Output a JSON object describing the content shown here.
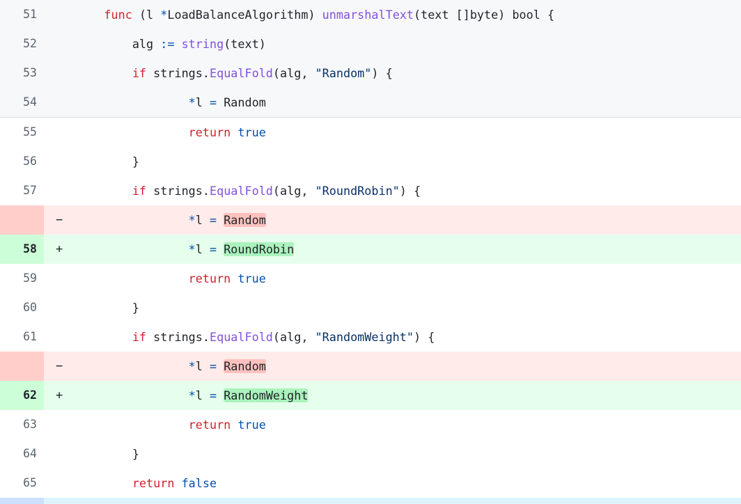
{
  "view": {
    "kind": "code-diff-unified",
    "language": "Go",
    "colors": {
      "page_bg": "#ffffff",
      "shaded_row_bg": "#f6f8fa",
      "shaded_row_border": "#d8dee4",
      "deletion_bg": "#ffebe9",
      "deletion_gutter_bg": "#ffcecb",
      "deletion_word_bg": "#ffc1bd",
      "addition_bg": "#e6ffec",
      "addition_gutter_bg": "#ccffd8",
      "addition_word_bg": "#abf2bc",
      "hunk_gutter_bg": "#cce0ff",
      "hunk_content_bg": "#ddf4ff",
      "line_number_color": "#59636e",
      "keyword": "#cf222e",
      "function": "#8250df",
      "operator_constant": "#0550ae",
      "string": "#0a3069",
      "plain": "#1f2328"
    }
  },
  "rows": [
    {
      "line_number": "51",
      "marker": "",
      "type": "shaded",
      "code_plain": "func (l *LoadBalanceAlgorithm) unmarshalText(text []byte) bool {",
      "tokens": [
        {
          "t": "    ",
          "c": "pl"
        },
        {
          "t": "func",
          "c": "kw"
        },
        {
          "t": " (l ",
          "c": "pl"
        },
        {
          "t": "*",
          "c": "op"
        },
        {
          "t": "LoadBalanceAlgorithm) ",
          "c": "pl"
        },
        {
          "t": "unmarshalText",
          "c": "fn"
        },
        {
          "t": "(text []byte) bool {",
          "c": "pl"
        }
      ]
    },
    {
      "line_number": "52",
      "marker": "",
      "type": "shaded",
      "code_plain": "        alg := string(text)",
      "tokens": [
        {
          "t": "        alg ",
          "c": "pl"
        },
        {
          "t": ":=",
          "c": "op"
        },
        {
          "t": " ",
          "c": "pl"
        },
        {
          "t": "string",
          "c": "fn"
        },
        {
          "t": "(text)",
          "c": "pl"
        }
      ]
    },
    {
      "line_number": "53",
      "marker": "",
      "type": "shaded",
      "code_plain": "        if strings.EqualFold(alg, \"Random\") {",
      "tokens": [
        {
          "t": "        ",
          "c": "pl"
        },
        {
          "t": "if",
          "c": "kw"
        },
        {
          "t": " strings.",
          "c": "pl"
        },
        {
          "t": "EqualFold",
          "c": "fn"
        },
        {
          "t": "(alg, ",
          "c": "pl"
        },
        {
          "t": "\"Random\"",
          "c": "str"
        },
        {
          "t": ") {",
          "c": "pl"
        }
      ]
    },
    {
      "line_number": "54",
      "marker": "",
      "type": "shaded-last",
      "code_plain": "                *l = Random",
      "tokens": [
        {
          "t": "                ",
          "c": "pl"
        },
        {
          "t": "*",
          "c": "op"
        },
        {
          "t": "l ",
          "c": "pl"
        },
        {
          "t": "=",
          "c": "op"
        },
        {
          "t": " Random",
          "c": "pl"
        }
      ]
    },
    {
      "line_number": "55",
      "marker": "",
      "type": "context",
      "code_plain": "                return true",
      "tokens": [
        {
          "t": "                ",
          "c": "pl"
        },
        {
          "t": "return",
          "c": "kw"
        },
        {
          "t": " ",
          "c": "pl"
        },
        {
          "t": "true",
          "c": "op"
        }
      ]
    },
    {
      "line_number": "56",
      "marker": "",
      "type": "context",
      "code_plain": "        }",
      "tokens": [
        {
          "t": "        }",
          "c": "pl"
        }
      ]
    },
    {
      "line_number": "57",
      "marker": "",
      "type": "context",
      "code_plain": "        if strings.EqualFold(alg, \"RoundRobin\") {",
      "tokens": [
        {
          "t": "        ",
          "c": "pl"
        },
        {
          "t": "if",
          "c": "kw"
        },
        {
          "t": " strings.",
          "c": "pl"
        },
        {
          "t": "EqualFold",
          "c": "fn"
        },
        {
          "t": "(alg, ",
          "c": "pl"
        },
        {
          "t": "\"RoundRobin\"",
          "c": "str"
        },
        {
          "t": ") {",
          "c": "pl"
        }
      ]
    },
    {
      "line_number": "",
      "marker": "−",
      "type": "deletion",
      "code_plain": "                *l = Random",
      "tokens": [
        {
          "t": "                ",
          "c": "pl"
        },
        {
          "t": "*",
          "c": "op"
        },
        {
          "t": "l ",
          "c": "pl"
        },
        {
          "t": "=",
          "c": "op"
        },
        {
          "t": " ",
          "c": "pl"
        },
        {
          "t": "Random",
          "c": "pl",
          "hl": "del"
        }
      ]
    },
    {
      "line_number": "58",
      "marker": "+",
      "type": "addition",
      "code_plain": "                *l = RoundRobin",
      "tokens": [
        {
          "t": "                ",
          "c": "pl"
        },
        {
          "t": "*",
          "c": "op"
        },
        {
          "t": "l ",
          "c": "pl"
        },
        {
          "t": "=",
          "c": "op"
        },
        {
          "t": " ",
          "c": "pl"
        },
        {
          "t": "RoundRobin",
          "c": "pl",
          "hl": "add"
        }
      ]
    },
    {
      "line_number": "59",
      "marker": "",
      "type": "context",
      "code_plain": "                return true",
      "tokens": [
        {
          "t": "                ",
          "c": "pl"
        },
        {
          "t": "return",
          "c": "kw"
        },
        {
          "t": " ",
          "c": "pl"
        },
        {
          "t": "true",
          "c": "op"
        }
      ]
    },
    {
      "line_number": "60",
      "marker": "",
      "type": "context",
      "code_plain": "        }",
      "tokens": [
        {
          "t": "        }",
          "c": "pl"
        }
      ]
    },
    {
      "line_number": "61",
      "marker": "",
      "type": "context",
      "code_plain": "        if strings.EqualFold(alg, \"RandomWeight\") {",
      "tokens": [
        {
          "t": "        ",
          "c": "pl"
        },
        {
          "t": "if",
          "c": "kw"
        },
        {
          "t": " strings.",
          "c": "pl"
        },
        {
          "t": "EqualFold",
          "c": "fn"
        },
        {
          "t": "(alg, ",
          "c": "pl"
        },
        {
          "t": "\"RandomWeight\"",
          "c": "str"
        },
        {
          "t": ") {",
          "c": "pl"
        }
      ]
    },
    {
      "line_number": "",
      "marker": "−",
      "type": "deletion",
      "code_plain": "                *l = Random",
      "tokens": [
        {
          "t": "                ",
          "c": "pl"
        },
        {
          "t": "*",
          "c": "op"
        },
        {
          "t": "l ",
          "c": "pl"
        },
        {
          "t": "=",
          "c": "op"
        },
        {
          "t": " ",
          "c": "pl"
        },
        {
          "t": "Random",
          "c": "pl",
          "hl": "del"
        }
      ]
    },
    {
      "line_number": "62",
      "marker": "+",
      "type": "addition",
      "code_plain": "                *l = RandomWeight",
      "tokens": [
        {
          "t": "                ",
          "c": "pl"
        },
        {
          "t": "*",
          "c": "op"
        },
        {
          "t": "l ",
          "c": "pl"
        },
        {
          "t": "=",
          "c": "op"
        },
        {
          "t": " ",
          "c": "pl"
        },
        {
          "t": "RandomWeight",
          "c": "pl",
          "hl": "add"
        }
      ]
    },
    {
      "line_number": "63",
      "marker": "",
      "type": "context",
      "code_plain": "                return true",
      "tokens": [
        {
          "t": "                ",
          "c": "pl"
        },
        {
          "t": "return",
          "c": "kw"
        },
        {
          "t": " ",
          "c": "pl"
        },
        {
          "t": "true",
          "c": "op"
        }
      ]
    },
    {
      "line_number": "64",
      "marker": "",
      "type": "context",
      "code_plain": "        }",
      "tokens": [
        {
          "t": "        }",
          "c": "pl"
        }
      ]
    },
    {
      "line_number": "65",
      "marker": "",
      "type": "context",
      "code_plain": "        return false",
      "tokens": [
        {
          "t": "        ",
          "c": "pl"
        },
        {
          "t": "return",
          "c": "kw"
        },
        {
          "t": " ",
          "c": "pl"
        },
        {
          "t": "false",
          "c": "op"
        }
      ]
    },
    {
      "line_number": "",
      "marker": "",
      "type": "hunk",
      "code_plain": "",
      "tokens": []
    }
  ]
}
